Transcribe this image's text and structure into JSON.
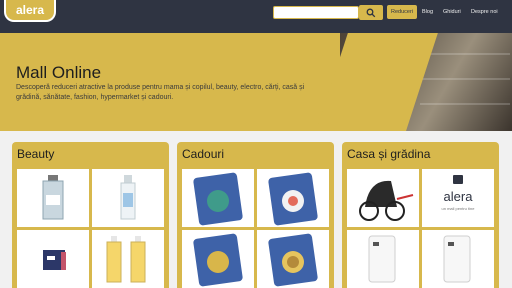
{
  "header": {
    "logo_text": "alera",
    "search": {
      "value": "",
      "placeholder": ""
    },
    "nav": {
      "discounts": "Reduceri",
      "blog": "Blog",
      "guides": "Ghiduri",
      "about": "Despre noi"
    }
  },
  "hero": {
    "title": "Mall Online",
    "description": "Descoperă reduceri atractive la produse pentru mama și copilul, beauty, electro, cărți, casă și grădină, sănătate, fashion, hypermarket și cadouri."
  },
  "categories": [
    {
      "title": "Beauty"
    },
    {
      "title": "Cadouri"
    },
    {
      "title": "Casa și grădina"
    }
  ],
  "products": {
    "alera_logo_text": "alera",
    "alera_tagline": "un mall pentru tine"
  },
  "colors": {
    "topbar": "#2f3442",
    "accent": "#d7b84c",
    "background": "#f1f1f1"
  }
}
